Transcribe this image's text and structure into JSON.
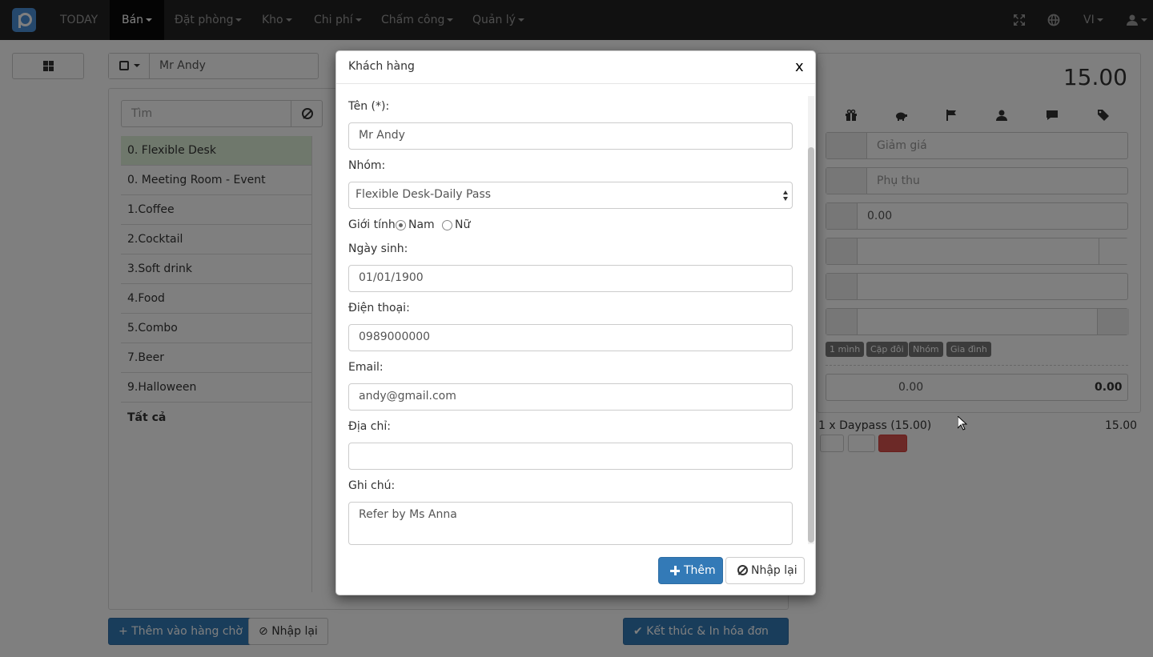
{
  "nav": {
    "today": "TODAY",
    "ban": "Bán",
    "dat_phong": "Đặt phòng",
    "kho": "Kho",
    "chi_phi": "Chi phí",
    "cham_cong": "Chấm công",
    "quan_ly": "Quản lý",
    "lang": "VI"
  },
  "customer_box": {
    "value": "Mr Andy"
  },
  "search": {
    "placeholder": "Tìm"
  },
  "categories": [
    "0. Flexible Desk",
    "0. Meeting Room - Event",
    "1.Coffee",
    "2.Cocktail",
    "3.Soft drink",
    "4.Food",
    "5.Combo",
    "7.Beer",
    "9.Halloween",
    "Tất cả"
  ],
  "right": {
    "total": "15.00",
    "discount_placeholder": "Giảm giá",
    "surcharge_placeholder": "Phụ thu",
    "flag_value": "0.00",
    "tags": [
      "1 mình",
      "Cặp đôi",
      "Nhóm",
      "Gia đình"
    ],
    "pay_value": "0.00",
    "change_value": "0.00",
    "order_line": "1 x Daypass (15.00)",
    "order_amount": "15.00"
  },
  "bottom": {
    "add_queue": "Thêm vào hàng chờ",
    "reset": "Nhập lại",
    "finish": "Kết thúc & In hóa đơn"
  },
  "modal": {
    "title": "Khách hàng",
    "close": "x",
    "name_label": "Tên (*):",
    "name_value": "Mr Andy",
    "group_label": "Nhóm:",
    "group_value": "Flexible Desk-Daily Pass",
    "gender_label": "Giới tính:",
    "gender_male": "Nam",
    "gender_female": "Nữ",
    "dob_label": "Ngày sinh:",
    "dob_value": "01/01/1900",
    "phone_label": "Điện thoại:",
    "phone_value": "0989000000",
    "email_label": "Email:",
    "email_value": "andy@gmail.com",
    "address_label": "Địa chỉ:",
    "address_value": "",
    "note_label": "Ghi chú:",
    "note_value": "Refer by Ms Anna",
    "add_button": "Thêm",
    "reset_button": "Nhập lại"
  }
}
